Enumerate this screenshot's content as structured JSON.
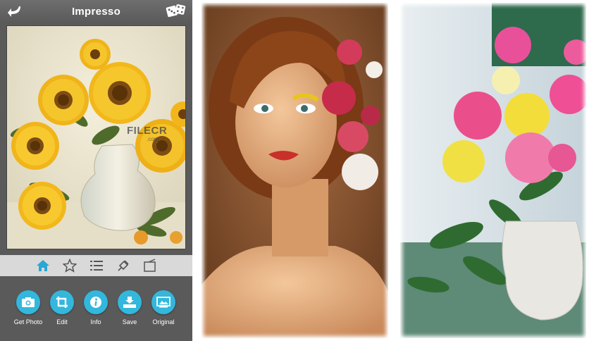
{
  "app": {
    "title": "Impresso",
    "back_icon": "back-arrow-icon",
    "random_icon": "dice-icon"
  },
  "watermark": {
    "text": "FILECR",
    "sub": ".com"
  },
  "tabs": [
    {
      "icon": "home-icon",
      "active": true
    },
    {
      "icon": "star-icon",
      "active": false
    },
    {
      "icon": "list-icon",
      "active": false
    },
    {
      "icon": "brush-icon",
      "active": false
    },
    {
      "icon": "canvas-icon",
      "active": false
    }
  ],
  "actions": [
    {
      "label": "Get Photo",
      "icon": "camera-icon"
    },
    {
      "label": "Edit",
      "icon": "crop-icon"
    },
    {
      "label": "Info",
      "icon": "info-icon"
    },
    {
      "label": "Save",
      "icon": "save-icon"
    },
    {
      "label": "Original",
      "icon": "original-image-icon"
    }
  ],
  "colors": {
    "accent": "#33b7dc",
    "toolbar": "#5a5a5a",
    "tabbar": "#d9d9d9"
  }
}
